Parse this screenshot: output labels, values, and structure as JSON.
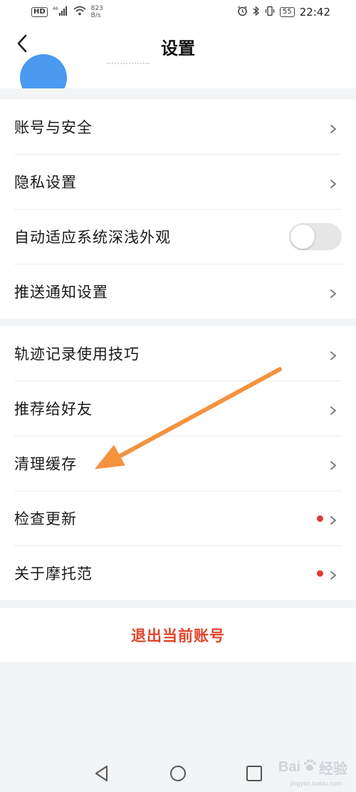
{
  "status_bar": {
    "hd": "HD",
    "signal": "46",
    "speed_value": "823",
    "speed_unit": "B/s",
    "battery": "55",
    "time": "22:42"
  },
  "header": {
    "title": "设置"
  },
  "group1": [
    {
      "label": "账号与安全"
    },
    {
      "label": "隐私设置"
    },
    {
      "label": "自动适应系统深浅外观",
      "toggle": false
    },
    {
      "label": "推送通知设置"
    }
  ],
  "group2": [
    {
      "label": "轨迹记录使用技巧"
    },
    {
      "label": "推荐给好友"
    },
    {
      "label": "清理缓存"
    },
    {
      "label": "检查更新",
      "badge": true
    },
    {
      "label": "关于摩托范",
      "badge": true
    }
  ],
  "logout": {
    "label": "退出当前账号"
  },
  "watermark": {
    "brand": "Bai",
    "brand_cn": "经验",
    "url": "jingyan.baidu.com"
  },
  "colors": {
    "accent_red": "#e0442a",
    "badge_red": "#e0383b",
    "avatar_blue": "#4a9af0",
    "annotation_orange": "#f5923e"
  }
}
